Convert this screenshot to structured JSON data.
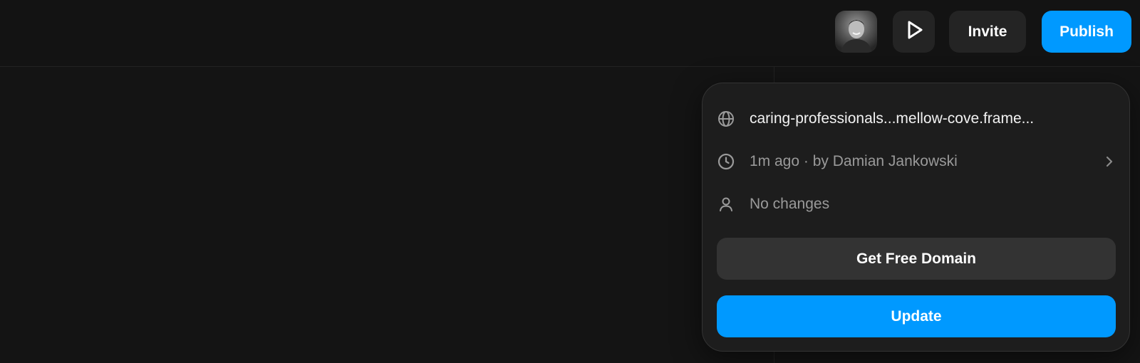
{
  "toolbar": {
    "invite_label": "Invite",
    "publish_label": "Publish",
    "preview_icon": "play-icon",
    "avatar_icon": "user-avatar"
  },
  "publish_popover": {
    "site_url": "caring-professionals...mellow-cove.frame...",
    "last_published": "1m ago · by Damian Jankowski",
    "change_status": "No changes",
    "get_domain_label": "Get Free Domain",
    "update_label": "Update",
    "icons": [
      "globe-icon",
      "clock-icon",
      "user-icon",
      "chevron-right-icon"
    ]
  },
  "colors": {
    "background": "#141414",
    "surface": "#1d1d1d",
    "button_secondary": "#242424",
    "accent": "#0099ff",
    "text_muted": "#9a9a9a"
  }
}
